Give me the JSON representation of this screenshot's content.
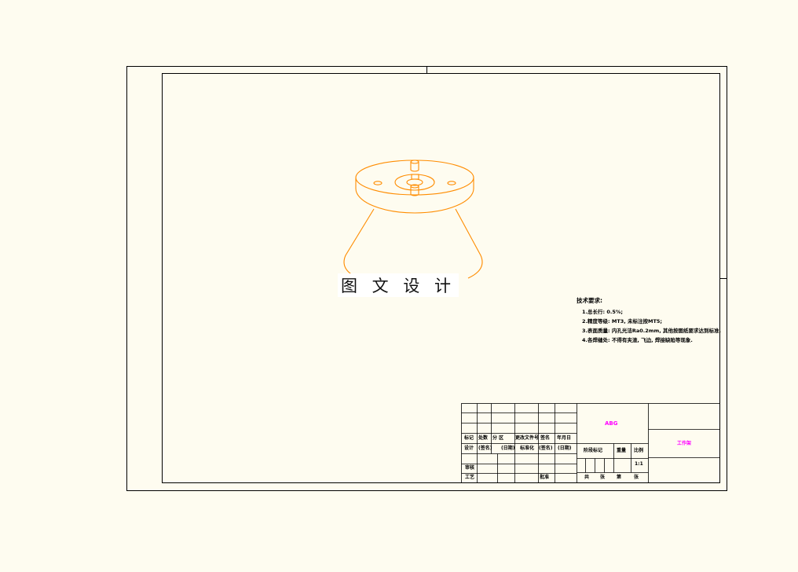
{
  "drawing": {
    "watermark": "图 文 设 计",
    "line_color": "#000000",
    "part_color": "#ff8c00",
    "magenta": "#ff00ff"
  },
  "tech_notes": {
    "heading": "技术要求:",
    "items": [
      "1.总长行: 0.5%;",
      "2.精度等级: MT3, 未标注按MT5;",
      "3.表面质量: 内孔光洁Ra0.2mm, 其他按图纸要求达到标准.",
      "4.各焊缝处: 不得有夹渣, 飞边, 焊接缺陷等现象."
    ]
  },
  "title_block": {
    "drawing_name": "ABG",
    "part_name": "工作架",
    "header_row": [
      "标记",
      "处数",
      "分 区",
      "更改文件号",
      "签名",
      "年月日"
    ],
    "design_row": [
      "设计",
      "(签名)",
      "(日期)",
      "标准化",
      "(签名)",
      "(日期)"
    ],
    "review_label": "审核",
    "process_label": "工艺",
    "approve_label": "批准",
    "stage_label": "阶段标记",
    "weight_label": "重量",
    "scale_label": "比例",
    "scale_value": "1:1",
    "sheet_total": "共",
    "sheet_total_unit": "张",
    "sheet_no": "第",
    "sheet_no_unit": "张"
  }
}
